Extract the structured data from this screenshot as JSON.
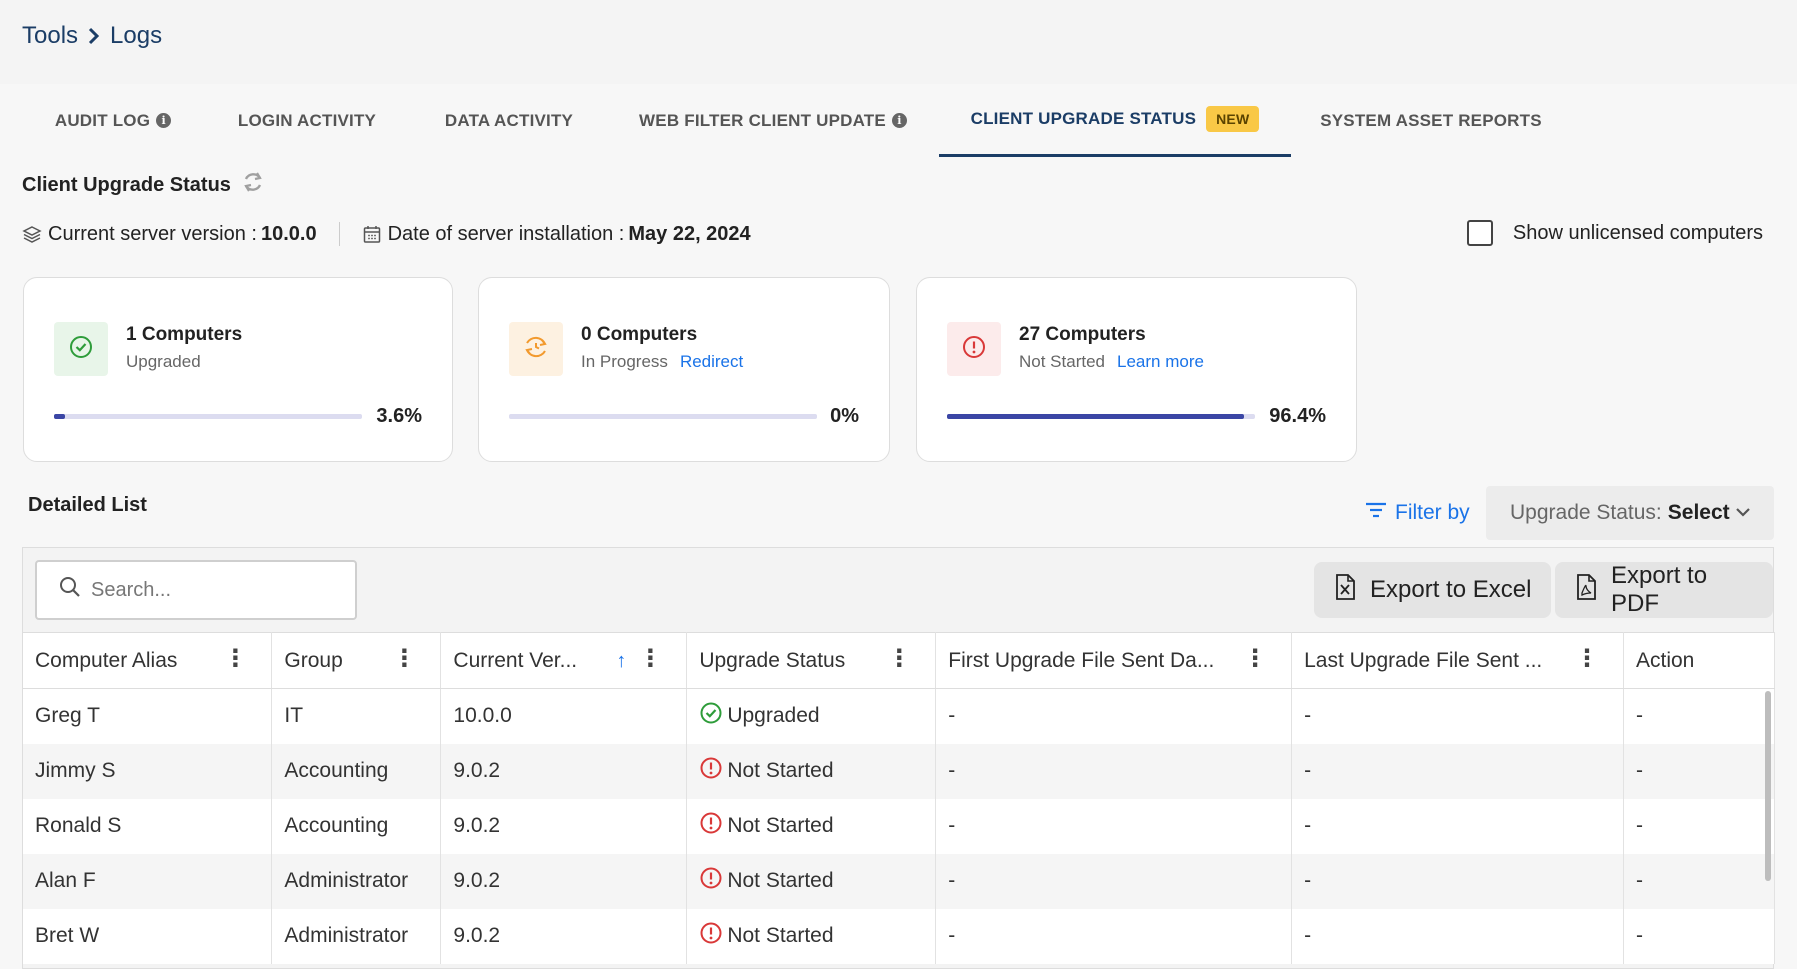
{
  "breadcrumb": {
    "parent": "Tools",
    "current": "Logs"
  },
  "tabs": [
    {
      "label": "AUDIT LOG"
    },
    {
      "label": "LOGIN ACTIVITY"
    },
    {
      "label": "DATA ACTIVITY"
    },
    {
      "label": "WEB FILTER CLIENT UPDATE"
    },
    {
      "label": "CLIENT UPGRADE STATUS",
      "badge": "NEW",
      "active": true
    },
    {
      "label": "SYSTEM ASSET REPORTS"
    }
  ],
  "section": {
    "title": "Client Upgrade Status"
  },
  "server": {
    "version_label": "Current server version :",
    "version": "10.0.0",
    "install_label": "Date of server installation :",
    "install_date": "May 22, 2024"
  },
  "unlicensed_label": "Show unlicensed computers",
  "cards": [
    {
      "count": "1 Computers",
      "status": "Upgraded",
      "link": "",
      "percent": "3.6%",
      "fill": 0.036,
      "color": "#2e9c3a",
      "bg": "#e8f5e9"
    },
    {
      "count": "0 Computers",
      "status": "In Progress",
      "link": "Redirect",
      "percent": "0%",
      "fill": 0,
      "color": "#f29a2e",
      "bg": "#fdf1e1"
    },
    {
      "count": "27 Computers",
      "status": "Not Started",
      "link": "Learn more",
      "percent": "96.4%",
      "fill": 0.964,
      "color": "#d93838",
      "bg": "#fcebeb"
    }
  ],
  "detail": {
    "title": "Detailed List",
    "filter_label": "Filter by",
    "select_label": "Upgrade Status:",
    "select_value": "Select",
    "search_placeholder": "Search...",
    "export_excel": "Export to Excel",
    "export_pdf": "Export to PDF"
  },
  "columns": [
    "Computer Alias",
    "Group",
    "Current Ver...",
    "Upgrade Status",
    "First Upgrade File Sent Da...",
    "Last Upgrade File Sent ...",
    "Action"
  ],
  "rows": [
    {
      "alias": "Greg T",
      "group": "IT",
      "version": "10.0.0",
      "status": "Upgraded",
      "first": "-",
      "last": "-",
      "action": "-"
    },
    {
      "alias": "Jimmy S",
      "group": "Accounting",
      "version": "9.0.2",
      "status": "Not Started",
      "first": "-",
      "last": "-",
      "action": "-"
    },
    {
      "alias": "Ronald S",
      "group": "Accounting",
      "version": "9.0.2",
      "status": "Not Started",
      "first": "-",
      "last": "-",
      "action": "-"
    },
    {
      "alias": "Alan F",
      "group": "Administrator",
      "version": "9.0.2",
      "status": "Not Started",
      "first": "-",
      "last": "-",
      "action": "-"
    },
    {
      "alias": "Bret W",
      "group": "Administrator",
      "version": "9.0.2",
      "status": "Not Started",
      "first": "-",
      "last": "-",
      "action": "-"
    }
  ]
}
